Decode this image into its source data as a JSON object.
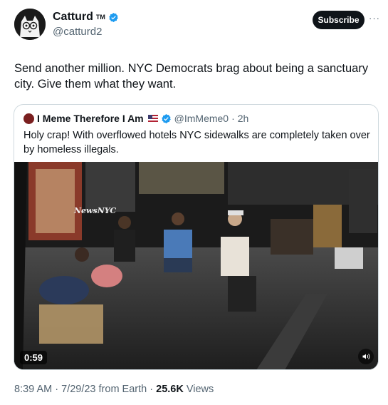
{
  "author": {
    "name": "Catturd",
    "tm": "TM",
    "handle": "@catturd2",
    "subscribe_label": "Subscribe",
    "more_label": "···"
  },
  "tweet_text": "Send another million. NYC Democrats brag about being a sanctuary city. Give them what they want.",
  "quoted": {
    "name": "I Meme Therefore I Am",
    "handle": "@ImMeme0",
    "separator": "·",
    "time": "2h",
    "text": "Holy crap! With overflowed hotels NYC sidewalks are completely taken over by homeless illegals.",
    "video": {
      "duration": "0:59",
      "watermark": "NewsNYC",
      "mute_icon": "speaker-icon"
    }
  },
  "meta": {
    "time": "8:39 AM",
    "date": "7/29/23",
    "source": "from Earth",
    "dot": "·",
    "views_count": "25.6K",
    "views_label": "Views"
  },
  "colors": {
    "verified": "#1d9bf0",
    "subscribe_bg": "#0f1419",
    "secondary_text": "#536471",
    "border": "#cfd9de"
  }
}
